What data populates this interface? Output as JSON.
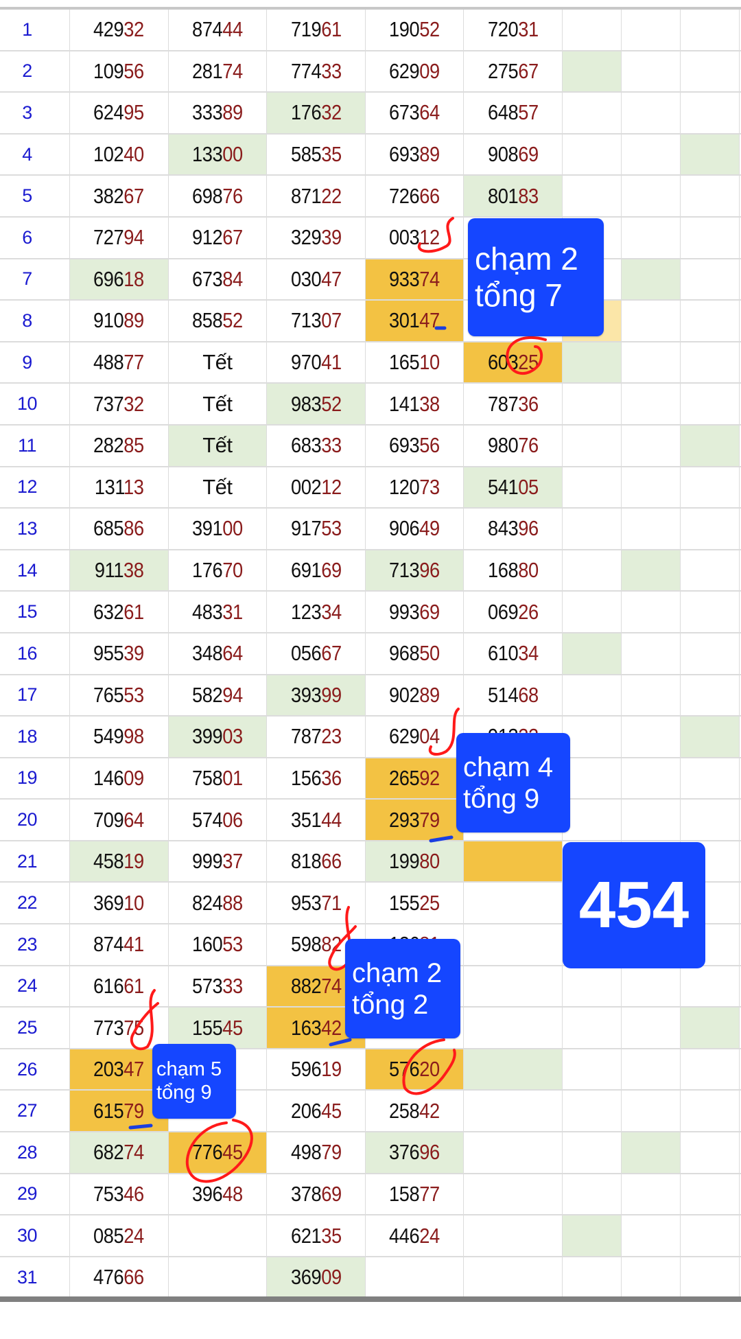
{
  "colors": {
    "row_number": "#1a1ad0",
    "tail_digits": "#8a1c1c",
    "green_fill": "#e2eed9",
    "orange_fill": "#f3c243",
    "light_yellow_fill": "#fbe6a8",
    "note_bg": "#1546ff",
    "pen_red": "#ff1a1a",
    "pen_blue": "#1a3ee0"
  },
  "rows": [
    {
      "n": "1",
      "cells": [
        "42932",
        "87444",
        "71961",
        "19052",
        "72031"
      ],
      "fills": [
        "",
        "",
        "",
        "",
        "",
        "",
        "",
        ""
      ]
    },
    {
      "n": "2",
      "cells": [
        "10956",
        "28174",
        "77433",
        "62909",
        "27567"
      ],
      "fills": [
        "",
        "",
        "",
        "",
        "",
        "g",
        "",
        ""
      ]
    },
    {
      "n": "3",
      "cells": [
        "62495",
        "33389",
        "17632",
        "67364",
        "64857"
      ],
      "fills": [
        "",
        "",
        "g",
        "",
        "",
        "",
        "",
        ""
      ]
    },
    {
      "n": "4",
      "cells": [
        "10240",
        "13300",
        "58535",
        "69389",
        "90869"
      ],
      "fills": [
        "",
        "g",
        "",
        "",
        "",
        "",
        "",
        "g"
      ]
    },
    {
      "n": "5",
      "cells": [
        "38267",
        "69876",
        "87122",
        "72666",
        "80183"
      ],
      "fills": [
        "",
        "",
        "",
        "",
        "g",
        "",
        "",
        ""
      ]
    },
    {
      "n": "6",
      "cells": [
        "72794",
        "91267",
        "32939",
        "00312",
        ""
      ],
      "fills": [
        "",
        "",
        "",
        "",
        "",
        "",
        "",
        ""
      ]
    },
    {
      "n": "7",
      "cells": [
        "69618",
        "67384",
        "03047",
        "93374",
        ""
      ],
      "fills": [
        "g",
        "",
        "",
        "o",
        "",
        "",
        "g",
        ""
      ]
    },
    {
      "n": "8",
      "cells": [
        "91089",
        "85852",
        "71307",
        "30147",
        ""
      ],
      "fills": [
        "",
        "",
        "",
        "o",
        "",
        "y",
        "",
        ""
      ]
    },
    {
      "n": "9",
      "cells": [
        "48877",
        "Tết",
        "97041",
        "16510",
        "60325"
      ],
      "fills": [
        "",
        "",
        "",
        "",
        "o",
        "g",
        "",
        ""
      ]
    },
    {
      "n": "10",
      "cells": [
        "73732",
        "Tết",
        "98352",
        "14138",
        "78736"
      ],
      "fills": [
        "",
        "",
        "g",
        "",
        "",
        "",
        "",
        ""
      ]
    },
    {
      "n": "11",
      "cells": [
        "28285",
        "Tết",
        "68333",
        "69356",
        "98076"
      ],
      "fills": [
        "",
        "g",
        "",
        "",
        "",
        "",
        "",
        "g"
      ]
    },
    {
      "n": "12",
      "cells": [
        "13113",
        "Tết",
        "00212",
        "12073",
        "54105"
      ],
      "fills": [
        "",
        "",
        "",
        "",
        "g",
        "",
        "",
        ""
      ]
    },
    {
      "n": "13",
      "cells": [
        "68586",
        "39100",
        "91753",
        "90649",
        "84396"
      ],
      "fills": [
        "",
        "",
        "",
        "",
        "",
        "",
        "",
        ""
      ]
    },
    {
      "n": "14",
      "cells": [
        "91138",
        "17670",
        "69169",
        "71396",
        "16880"
      ],
      "fills": [
        "g",
        "",
        "",
        "g",
        "",
        "",
        "g",
        ""
      ]
    },
    {
      "n": "15",
      "cells": [
        "63261",
        "48331",
        "12334",
        "99369",
        "06926"
      ],
      "fills": [
        "",
        "",
        "",
        "",
        "",
        "",
        "",
        ""
      ]
    },
    {
      "n": "16",
      "cells": [
        "95539",
        "34864",
        "05667",
        "96850",
        "61034"
      ],
      "fills": [
        "",
        "",
        "",
        "",
        "",
        "g",
        "",
        ""
      ]
    },
    {
      "n": "17",
      "cells": [
        "76553",
        "58294",
        "39399",
        "90289",
        "51468"
      ],
      "fills": [
        "",
        "",
        "g",
        "",
        "",
        "",
        "",
        ""
      ]
    },
    {
      "n": "18",
      "cells": [
        "54998",
        "39903",
        "78723",
        "62904",
        "91322"
      ],
      "fills": [
        "",
        "g",
        "",
        "",
        "",
        "",
        "",
        "g"
      ]
    },
    {
      "n": "19",
      "cells": [
        "14609",
        "75801",
        "15636",
        "26592",
        ""
      ],
      "fills": [
        "",
        "",
        "",
        "o",
        "",
        "",
        "",
        ""
      ]
    },
    {
      "n": "20",
      "cells": [
        "70964",
        "57406",
        "35144",
        "29379",
        ""
      ],
      "fills": [
        "",
        "",
        "",
        "o",
        "",
        "",
        "",
        ""
      ]
    },
    {
      "n": "21",
      "cells": [
        "45819",
        "99937",
        "81866",
        "19980",
        ""
      ],
      "fills": [
        "g",
        "",
        "",
        "g",
        "o",
        "",
        "",
        ""
      ]
    },
    {
      "n": "22",
      "cells": [
        "36910",
        "82488",
        "95371",
        "15525",
        ""
      ],
      "fills": [
        "",
        "",
        "",
        "",
        "",
        "",
        "",
        ""
      ]
    },
    {
      "n": "23",
      "cells": [
        "87441",
        "16053",
        "59882",
        "12681",
        ""
      ],
      "fills": [
        "",
        "",
        "",
        "",
        "",
        "",
        "",
        ""
      ]
    },
    {
      "n": "24",
      "cells": [
        "61661",
        "57333",
        "88274",
        "",
        ""
      ],
      "fills": [
        "",
        "",
        "o",
        "",
        "",
        "",
        "",
        ""
      ]
    },
    {
      "n": "25",
      "cells": [
        "77375",
        "15545",
        "16342",
        "",
        ""
      ],
      "fills": [
        "",
        "g",
        "o",
        "",
        "",
        "",
        "",
        "g"
      ]
    },
    {
      "n": "26",
      "cells": [
        "20347",
        "",
        "59619",
        "57620",
        ""
      ],
      "fills": [
        "o",
        "",
        "",
        "o",
        "g",
        "",
        "",
        ""
      ]
    },
    {
      "n": "27",
      "cells": [
        "61579",
        "",
        "20645",
        "25842",
        ""
      ],
      "fills": [
        "o",
        "",
        "",
        "",
        "",
        "",
        "",
        ""
      ]
    },
    {
      "n": "28",
      "cells": [
        "68274",
        "77645",
        "49879",
        "37696",
        ""
      ],
      "fills": [
        "g",
        "o",
        "",
        "g",
        "",
        "",
        "g",
        ""
      ]
    },
    {
      "n": "29",
      "cells": [
        "75346",
        "39648",
        "37869",
        "15877",
        ""
      ],
      "fills": [
        "",
        "",
        "",
        "",
        "",
        "",
        "",
        ""
      ]
    },
    {
      "n": "30",
      "cells": [
        "08524",
        "",
        "62135",
        "44624",
        ""
      ],
      "fills": [
        "",
        "",
        "",
        "",
        "",
        "g",
        "",
        ""
      ]
    },
    {
      "n": "31",
      "cells": [
        "47666",
        "",
        "36909",
        "",
        ""
      ],
      "fills": [
        "",
        "",
        "g",
        "",
        "",
        "",
        "",
        ""
      ]
    }
  ],
  "notes": {
    "n1": {
      "line1": "chạm 2",
      "line2": "tổng 7"
    },
    "n2": {
      "line1": "chạm 4",
      "line2": "tổng 9"
    },
    "n3": {
      "line1": "chạm 2",
      "line2": "tổng 2"
    },
    "n4": {
      "line1": "chạm 5",
      "line2": "tổng 9"
    },
    "big": "454"
  }
}
